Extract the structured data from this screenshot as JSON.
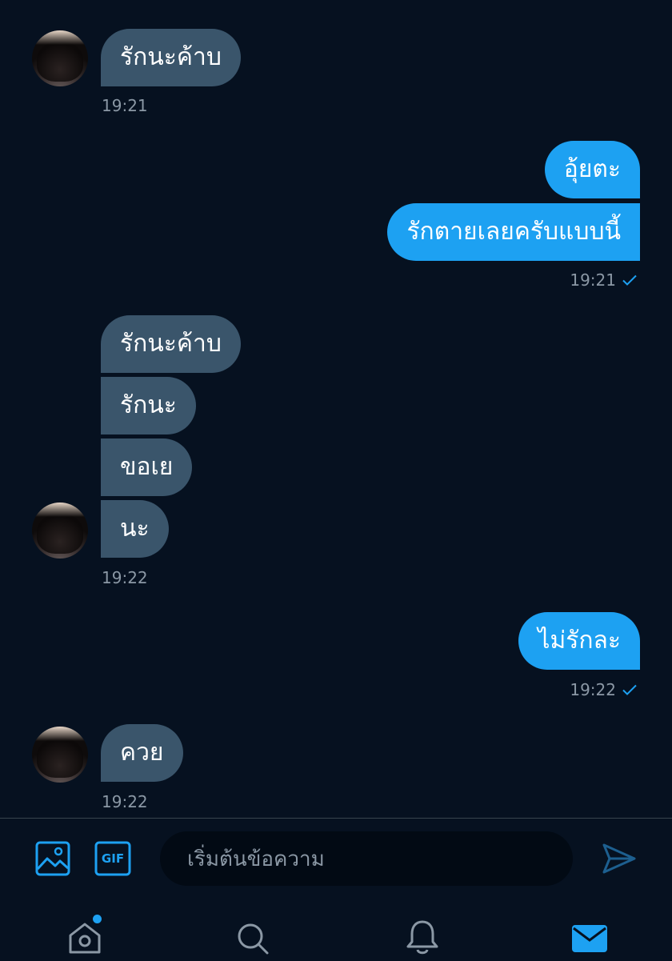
{
  "messages": {
    "m1": "รักนะค้าบ",
    "t1": "19:21",
    "m2": "อุ้ยตะ",
    "m3": "รักตายเลยครับแบบนี้",
    "t2": "19:21",
    "m4": "รักนะค้าบ",
    "m5": "รักนะ",
    "m6": "ขอเย",
    "m7": "นะ",
    "t3": "19:22",
    "m8": "ไม่รักละ",
    "t4": "19:22",
    "m9": "ควย",
    "t5": "19:22"
  },
  "composer": {
    "placeholder": "เริ่มต้นข้อความ",
    "gif_label": "GIF"
  },
  "colors": {
    "background": "#061120",
    "incoming_bubble": "#3a556b",
    "outgoing_bubble": "#1da1f2",
    "accent": "#1da1f2",
    "timestamp": "#8b98a5"
  },
  "icons": {
    "media": "image-icon",
    "gif": "gif-icon",
    "send": "send-icon",
    "read_receipt": "check-icon",
    "nav": [
      "home-icon",
      "search-icon",
      "notifications-icon",
      "messages-icon"
    ]
  }
}
